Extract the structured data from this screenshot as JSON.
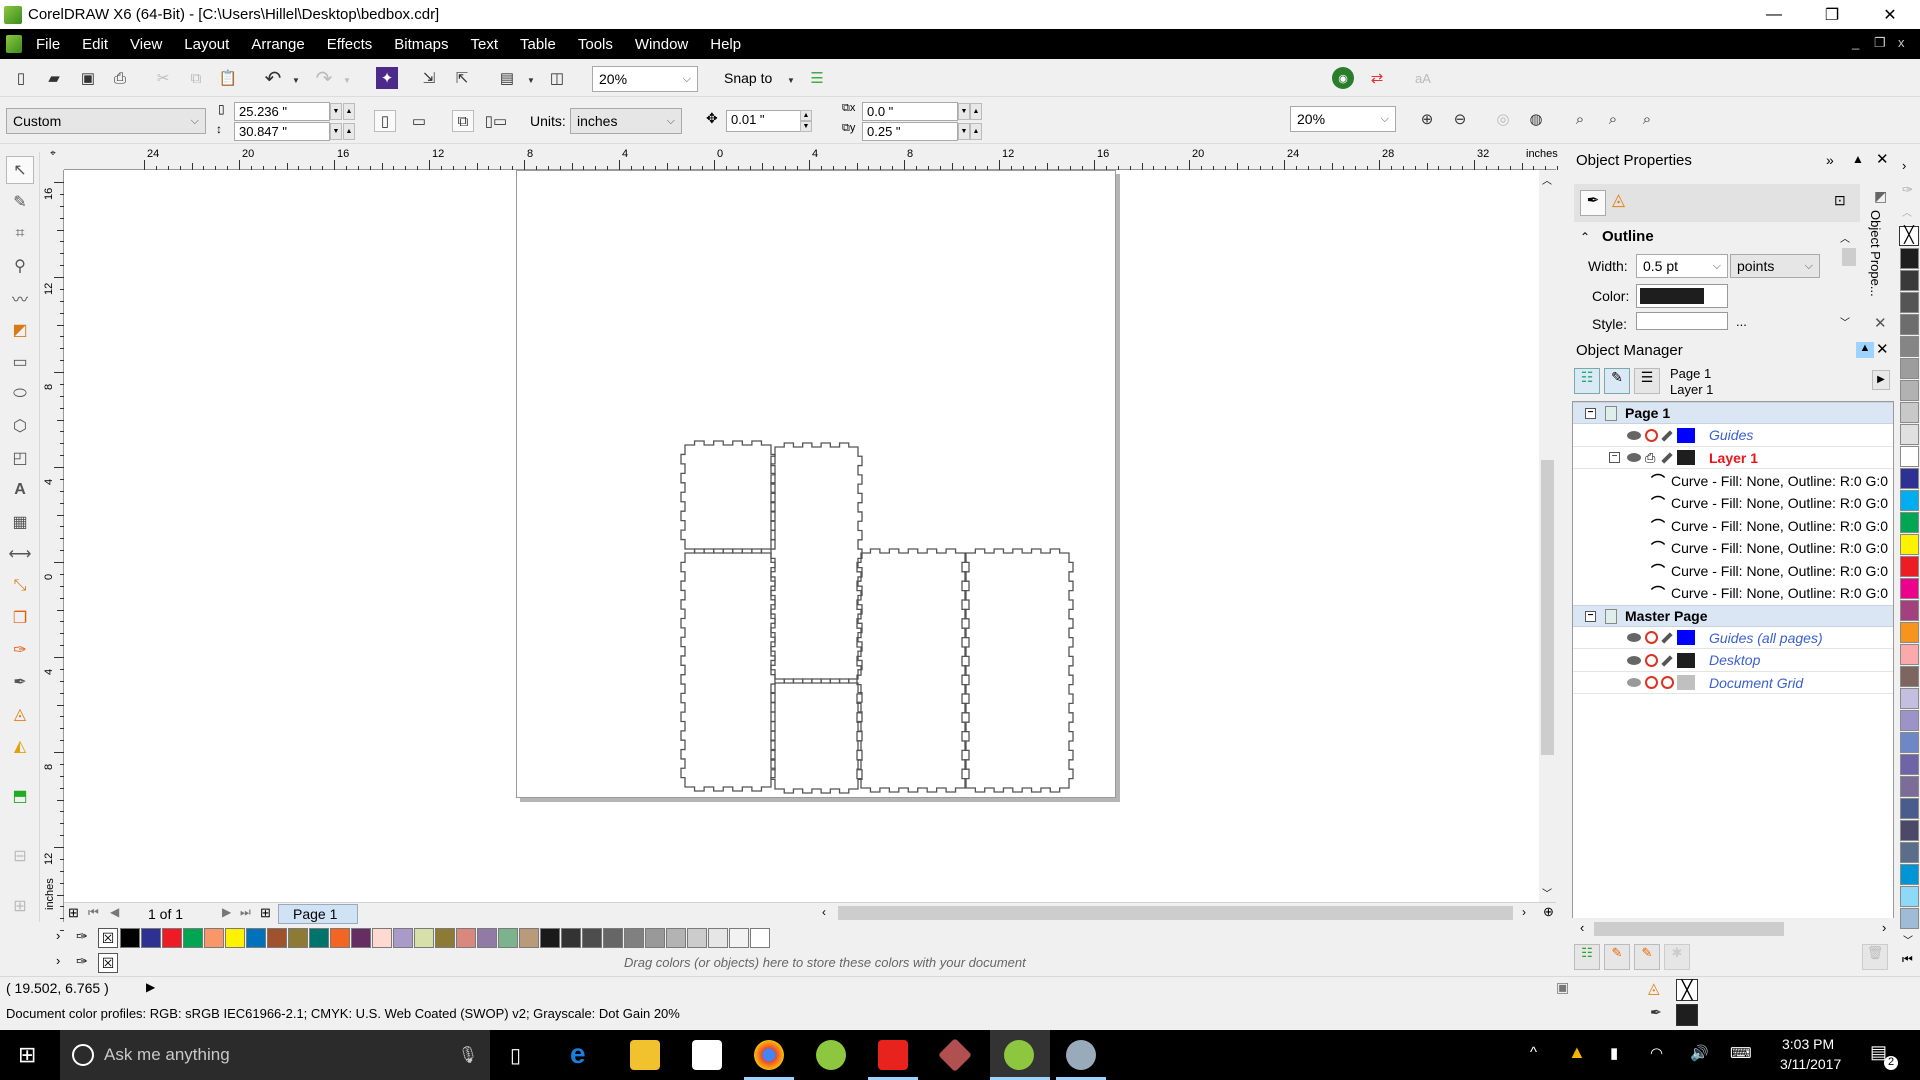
{
  "window": {
    "title": "CorelDRAW X6 (64-Bit) - [C:\\Users\\Hillel\\Desktop\\bedbox.cdr]",
    "controls": {
      "minimize": "—",
      "restore": "❐",
      "close": "✕"
    },
    "doc_controls": {
      "minimize": "_",
      "restore": "❐",
      "close": "x"
    }
  },
  "menu": {
    "items": [
      {
        "label": "File"
      },
      {
        "label": "Edit"
      },
      {
        "label": "View"
      },
      {
        "label": "Layout"
      },
      {
        "label": "Arrange"
      },
      {
        "label": "Effects"
      },
      {
        "label": "Bitmaps"
      },
      {
        "label": "Text"
      },
      {
        "label": "Table"
      },
      {
        "label": "Tools"
      },
      {
        "label": "Window"
      },
      {
        "label": "Help"
      }
    ]
  },
  "standard_toolbar": {
    "icons": [
      "new-icon",
      "open-icon",
      "save-icon",
      "print-icon",
      "cut-icon",
      "copy-icon",
      "paste-icon",
      "undo-icon",
      "redo-icon",
      "search-content-icon",
      "import-icon",
      "export-icon",
      "publish-pdf-icon",
      "application-launcher-icon"
    ],
    "zoom_value": "20%",
    "snap_to_label": "Snap to",
    "right_icons": [
      "welcome-screen-icon",
      "corel-connect-icon",
      "text-orientation-icon"
    ]
  },
  "property_bar": {
    "page_size": "Custom",
    "page_width": "25.236 \"",
    "page_height": "30.847 \"",
    "units_label": "Units:",
    "units_value": "inches",
    "nudge": "0.01 \"",
    "duplicate_x": "0.0 \"",
    "duplicate_y": "0.25 \"",
    "zoom_value": "20%"
  },
  "rulers": {
    "horizontal_labels": [
      "24",
      "20",
      "16",
      "12",
      "8",
      "4",
      "0",
      "4",
      "8",
      "12",
      "16",
      "20",
      "24",
      "28",
      "32"
    ],
    "horizontal_unit": "inches",
    "vertical_labels": [
      "16",
      "12",
      "8",
      "4",
      "0",
      "4",
      "8",
      "12"
    ],
    "vertical_unit": "inches"
  },
  "page_nav": {
    "counter": "1 of 1",
    "page_tab": "Page 1"
  },
  "palette": {
    "colors": [
      "#000000",
      "#2e3192",
      "#ed1c24",
      "#00a651",
      "#f7976a",
      "#fff200",
      "#0072bc",
      "#a0522d",
      "#8c7a35",
      "#00746b",
      "#f26522",
      "#662d63",
      "#fdd9d2",
      "#aa9ac7",
      "#d7e0a9",
      "#8c7a35",
      "#d98880",
      "#927aa6",
      "#7db38c",
      "#b99a7b",
      "#1a1a1a",
      "#333333",
      "#4d4d4d",
      "#666666",
      "#808080",
      "#999999",
      "#b3b3b3",
      "#cccccc",
      "#e6e6e6",
      "#f2f2f2",
      "#ffffff"
    ],
    "document_palette_hint": "Drag colors (or objects) here to store these colors with your document"
  },
  "status": {
    "cursor_position": "( 19.502, 6.765 )",
    "color_profiles": "Document color profiles: RGB: sRGB IEC61966-2.1; CMYK: U.S. Web Coated (SWOP) v2; Grayscale: Dot Gain 20%"
  },
  "object_properties": {
    "title": "Object Properties",
    "section": "Outline",
    "width_label": "Width:",
    "width_value": "0.5 pt",
    "width_units": "points",
    "color_label": "Color:",
    "outline_color": "#1e1e1e",
    "style_label": "Style:",
    "style_more": "...",
    "side_tab": "Object Prope..."
  },
  "object_manager": {
    "title": "Object Manager",
    "current_page": "Page 1",
    "current_layer": "Layer 1",
    "tree": [
      {
        "type": "page",
        "label": "Page 1"
      },
      {
        "type": "layer",
        "label": "Guides",
        "color": "#0000ff",
        "style": "italic"
      },
      {
        "type": "layer",
        "label": "Layer 1",
        "color": "#1e1e1e",
        "style": "active"
      },
      {
        "type": "object",
        "label": "Curve - Fill: None, Outline: R:0 G:0"
      },
      {
        "type": "object",
        "label": "Curve - Fill: None, Outline: R:0 G:0"
      },
      {
        "type": "object",
        "label": "Curve - Fill: None, Outline: R:0 G:0"
      },
      {
        "type": "object",
        "label": "Curve - Fill: None, Outline: R:0 G:0"
      },
      {
        "type": "object",
        "label": "Curve - Fill: None, Outline: R:0 G:0"
      },
      {
        "type": "object",
        "label": "Curve - Fill: None, Outline: R:0 G:0"
      },
      {
        "type": "page",
        "label": "Master Page"
      },
      {
        "type": "master-layer",
        "label": "Guides (all pages)",
        "color": "#0000ff"
      },
      {
        "type": "master-layer",
        "label": "Desktop",
        "color": "#1e1e1e"
      },
      {
        "type": "master-layer",
        "label": "Document Grid",
        "color": "#c0c0c0"
      }
    ]
  },
  "fill_outline_indicator": {
    "fill": "none",
    "outline": "#1e1e1e"
  },
  "right_palette": [
    "#1e1e1e",
    "#3a3a3a",
    "#555555",
    "#6d6d6d",
    "#858585",
    "#9d9d9d",
    "#b2b2b2",
    "#c8c8c8",
    "#e0e0e0",
    "#ffffff",
    "#2e3192",
    "#00aeef",
    "#00a651",
    "#fff200",
    "#ed1c24",
    "#ec008c",
    "#a3417f",
    "#f7941d",
    "#f9aaa9",
    "#7d6560",
    "#c4bfdf",
    "#9c93c9",
    "#6e88c7",
    "#6f64a8",
    "#7b6c98",
    "#4a5c8c",
    "#4b4868",
    "#5a6e8a",
    "#0096d6",
    "#8ed8f8",
    "#9fbcd6"
  ],
  "taskbar": {
    "search_placeholder": "Ask me anything",
    "time": "3:03 PM",
    "date": "3/11/2017",
    "notifications": "2"
  }
}
